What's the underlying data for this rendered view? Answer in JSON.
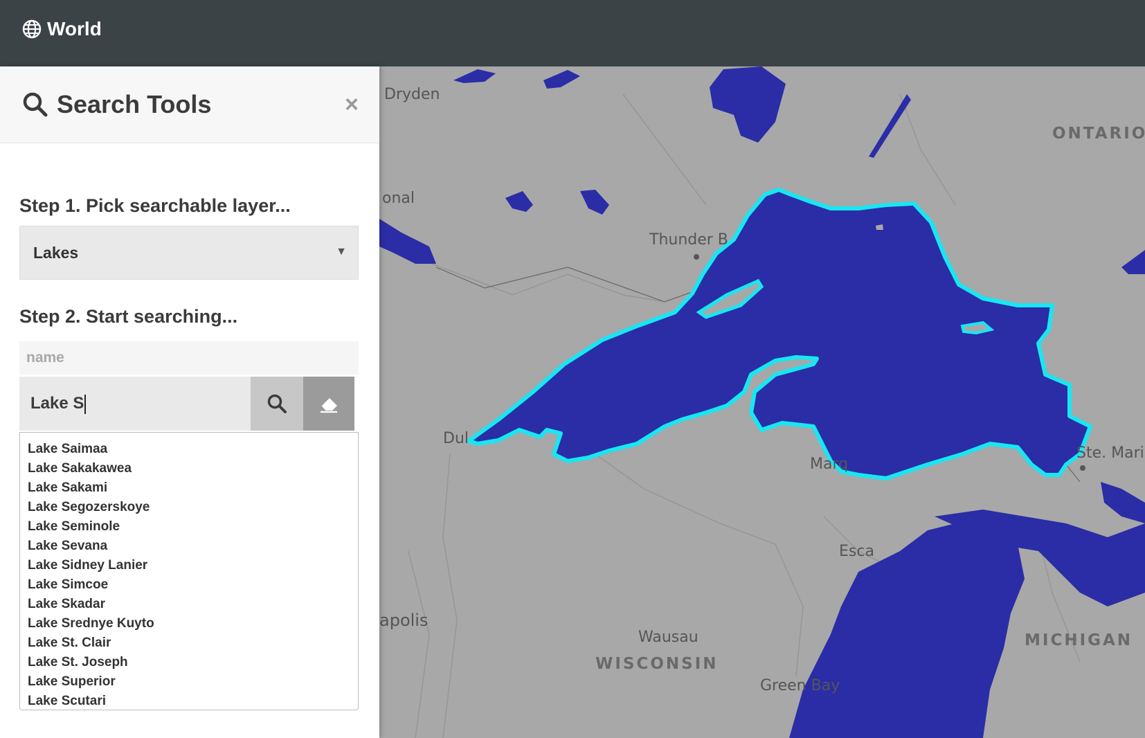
{
  "app": {
    "title": "World",
    "icon": "globe-icon"
  },
  "panel": {
    "title": "Search Tools",
    "title_icon": "search-icon",
    "close_label": "×",
    "step1_label": "Step 1. Pick searchable layer...",
    "layer_select": {
      "value": "Lakes"
    },
    "step2_label": "Step 2. Start searching...",
    "field_label": "name",
    "search_value": "Lake S",
    "results": [
      "Lake Saimaa",
      "Lake Sakakawea",
      "Lake Sakami",
      "Lake Segozerskoye",
      "Lake Seminole",
      "Lake Sevana",
      "Lake Sidney Lanier",
      "Lake Simcoe",
      "Lake Skadar",
      "Lake Srednye Kuyto",
      "Lake St. Clair",
      "Lake St. Joseph",
      "Lake Superior",
      "Lake Scutari"
    ]
  },
  "map": {
    "labels": {
      "dryden": "Dryden",
      "ontario": "ONTARIO",
      "onal": "onal",
      "thunder_bay": "Thunder B",
      "duluth": "Dul",
      "marquette": "Marq",
      "ste_marie": "Ste. Mari",
      "escanaba": "Esca",
      "apolis": "apolis",
      "wausau": "Wausau",
      "wisconsin": "WISCONSIN",
      "michigan": "MICHIGAN",
      "green_bay": "Green Bay"
    },
    "colors": {
      "lake_fill": "#2a2da6",
      "highlight": "#19e6f2",
      "land": "#a8a8a8"
    }
  }
}
